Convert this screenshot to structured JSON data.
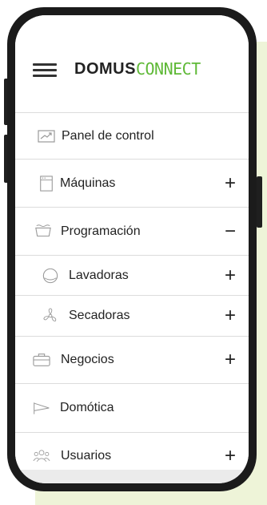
{
  "app": {
    "logo_primary": "DOMUS",
    "logo_accent": "CONNECT",
    "accent_color": "#5fb937"
  },
  "menu": [
    {
      "label": "Panel de control",
      "icon": "chart-icon",
      "toggle": ""
    },
    {
      "label": "Máquinas",
      "icon": "machine-icon",
      "toggle": "+"
    },
    {
      "label": "Programación",
      "icon": "tub-icon",
      "toggle": "−"
    },
    {
      "label": "Lavadoras",
      "icon": "circle-icon",
      "toggle": "+"
    },
    {
      "label": "Secadoras",
      "icon": "fan-icon",
      "toggle": "+"
    },
    {
      "label": "Negocios",
      "icon": "briefcase-icon",
      "toggle": "+"
    },
    {
      "label": "Domótica",
      "icon": "flag-icon",
      "toggle": ""
    },
    {
      "label": "Usuarios",
      "icon": "users-icon",
      "toggle": "+"
    }
  ]
}
